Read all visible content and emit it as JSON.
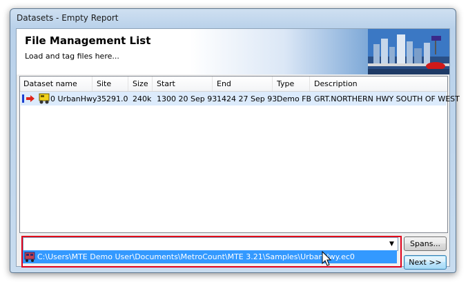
{
  "window": {
    "title": "Datasets - Empty Report"
  },
  "header": {
    "title": "File Management List",
    "subtitle": "Load and tag files here..."
  },
  "list": {
    "columns": [
      "Dataset name",
      "Site",
      "Size",
      "Start",
      "End",
      "Type",
      "Description"
    ],
    "rows": [
      {
        "dataset_name": "0 UrbanHwy",
        "site": "35291.0",
        "size": "240k",
        "start": "1300 20 Sep 93",
        "end": "1424 27 Sep 93",
        "type": "Demo FB",
        "description": "GRT.NORTHERN HWY SOUTH OF WEST"
      }
    ]
  },
  "file_combo": {
    "value": "",
    "dropdown_item": "C:\\Users\\MTE Demo User\\Documents\\MetroCount\\MTE 3.21\\Samples\\UrbanHwy.ec0"
  },
  "buttons": {
    "spans": "Spans...",
    "next": "Next >>"
  },
  "colors": {
    "selection": "#3399ff",
    "highlight_box": "#e0001a",
    "row_selected": "#dcebfc"
  }
}
